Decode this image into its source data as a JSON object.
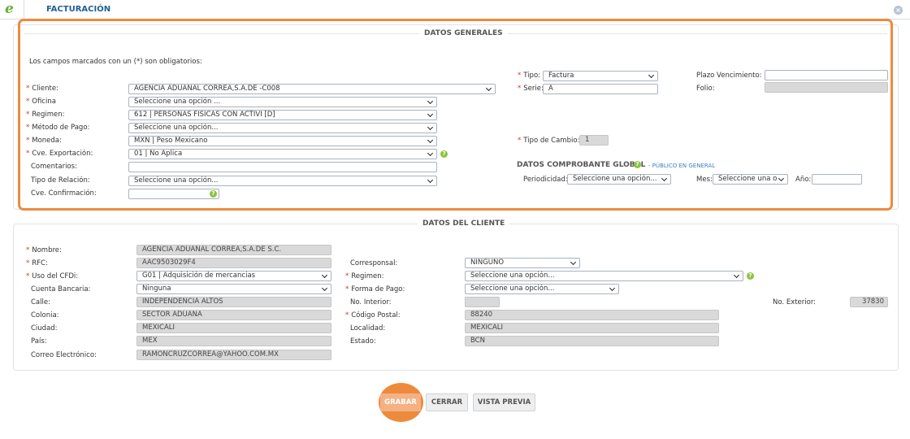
{
  "window": {
    "title": "FACTURACIÓN",
    "logo_letter": "e",
    "close_glyph": "×"
  },
  "datos_generales": {
    "legend": "DATOS GENERALES",
    "required_note": "Los campos marcados con un (*) son obligatorios:",
    "required_mark": "*",
    "cliente": {
      "label": "Cliente:",
      "value": "AGENCIA ADUANAL CORREA,S.A.DE -C008"
    },
    "oficina": {
      "label": "Oficina",
      "value": "Seleccione una opción ..."
    },
    "regimen": {
      "label": "Regimen:",
      "value": "612 | PERSONAS FISICAS CON ACTIVI [D]"
    },
    "metodo_pago": {
      "label": "Método de Pago:",
      "value": "Seleccione una opción..."
    },
    "moneda": {
      "label": "Moneda:",
      "value": "MXN | Peso Mexicano"
    },
    "cve_exportacion": {
      "label": "Cve. Exportación:",
      "value": "01 | No Aplica"
    },
    "comentarios": {
      "label": "Comentarios:",
      "value": ""
    },
    "tipo_relacion": {
      "label": "Tipo de Relación:",
      "value": "Seleccione una opción..."
    },
    "cve_confirmacion": {
      "label": "Cve. Confirmación:",
      "value": ""
    },
    "tipo": {
      "label": "Tipo:",
      "value": "Factura"
    },
    "serie": {
      "label": "Serie:",
      "value": "A"
    },
    "plazo_vencimiento": {
      "label": "Plazo Vencimiento:",
      "value": ""
    },
    "folio": {
      "label": "Folio:",
      "value": ""
    },
    "tipo_cambio": {
      "label": "Tipo de Cambio:",
      "value": "1"
    },
    "comprobante_global": {
      "title": "DATOS COMPROBANTE GLOBAL",
      "link": "- PÚBLICO EN GENERAL",
      "periodicidad": {
        "label": "Periodicidad:",
        "value": "Seleccione una opción..."
      },
      "mes": {
        "label": "Mes:",
        "value": "Seleccione una o"
      },
      "anio": {
        "label": "Año:",
        "value": ""
      }
    },
    "help_glyph": "?"
  },
  "datos_cliente": {
    "legend": "DATOS DEL CLIENTE",
    "nombre": {
      "label": "Nombre:",
      "value": "AGENCIA ADUANAL CORREA,S.A.DE S.C."
    },
    "rfc": {
      "label": "RFC:",
      "value": "AAC9503029F4"
    },
    "uso_cfdi": {
      "label": "Uso del CFDi:",
      "value": "G01 | Adquisición de mercancias"
    },
    "cuenta_bancaria": {
      "label": "Cuenta Bancaria:",
      "value": "Ninguna"
    },
    "calle": {
      "label": "Calle:",
      "value": "INDEPENDENCIA ALTOS"
    },
    "colonia": {
      "label": "Colonia:",
      "value": "SECTOR ADUANA"
    },
    "ciudad": {
      "label": "Ciudad:",
      "value": "MEXICALI"
    },
    "pais": {
      "label": "País:",
      "value": "MEX"
    },
    "correo": {
      "label": "Correo Electrónico:",
      "value": "RAMONCRUZCORREA@YAHOO.COM.MX"
    },
    "corresponsal": {
      "label": "Corresponsal:",
      "value": "NINGUNO"
    },
    "regimen": {
      "label": "Regimen:",
      "value": "Seleccione una opción..."
    },
    "forma_pago": {
      "label": "Forma de Pago:",
      "value": "Seleccione una opción..."
    },
    "no_interior": {
      "label": "No. Interior:",
      "value": ""
    },
    "codigo_postal": {
      "label": "Código Postal:",
      "value": "88240"
    },
    "localidad": {
      "label": "Localidad:",
      "value": "MEXICALI"
    },
    "estado": {
      "label": "Estado:",
      "value": "BCN"
    },
    "no_exterior": {
      "label": "No. Exterior:",
      "value": "37830"
    }
  },
  "actions": {
    "grabar": "GRABAR",
    "cerrar": "CERRAR",
    "vista_previa": "VISTA PREVIA"
  },
  "colors": {
    "highlight": "#ee8a3c",
    "accent_blue": "#1f5f99",
    "required": "#d0342c",
    "help_green": "#8cc43f",
    "logo_green": "#5fb331"
  }
}
